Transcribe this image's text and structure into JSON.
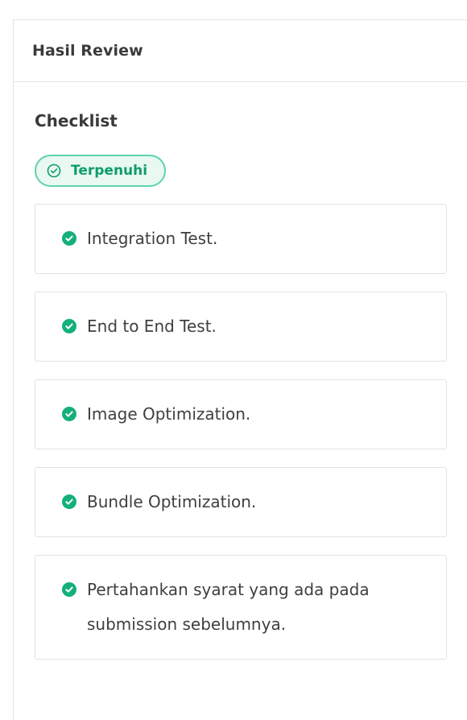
{
  "card": {
    "title": "Hasil Review"
  },
  "checklist": {
    "title": "Checklist",
    "status": {
      "label": "Terpenuhi",
      "icon": "check-circle-outline-icon",
      "color": "#0f9d6a"
    },
    "items": [
      {
        "label": "Integration Test.",
        "icon": "check-circle-icon"
      },
      {
        "label": "End to End Test.",
        "icon": "check-circle-icon"
      },
      {
        "label": "Image Optimization.",
        "icon": "check-circle-icon"
      },
      {
        "label": "Bundle Optimization.",
        "icon": "check-circle-icon"
      },
      {
        "label": "Pertahankan syarat yang ada pada submission sebelumnya.",
        "icon": "check-circle-icon"
      }
    ]
  },
  "colors": {
    "accent": "#15b07a",
    "pill_border": "#5ed3a9",
    "pill_background": "#e9f9f2",
    "border": "#e2e2e2"
  }
}
